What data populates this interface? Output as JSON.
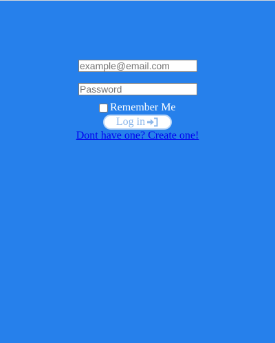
{
  "login": {
    "email_placeholder": "example@email.com",
    "password_placeholder": "Password",
    "remember_label": "Remember Me",
    "login_label": "Log in",
    "signup_link": "Dont have one? Create one!"
  },
  "icons": {
    "login_icon": "sign-in-icon"
  },
  "colors": {
    "background": "#2680EB",
    "link": "#0000EE",
    "button_text": "#8DB7EA",
    "button_border": "#B9D6F7"
  }
}
